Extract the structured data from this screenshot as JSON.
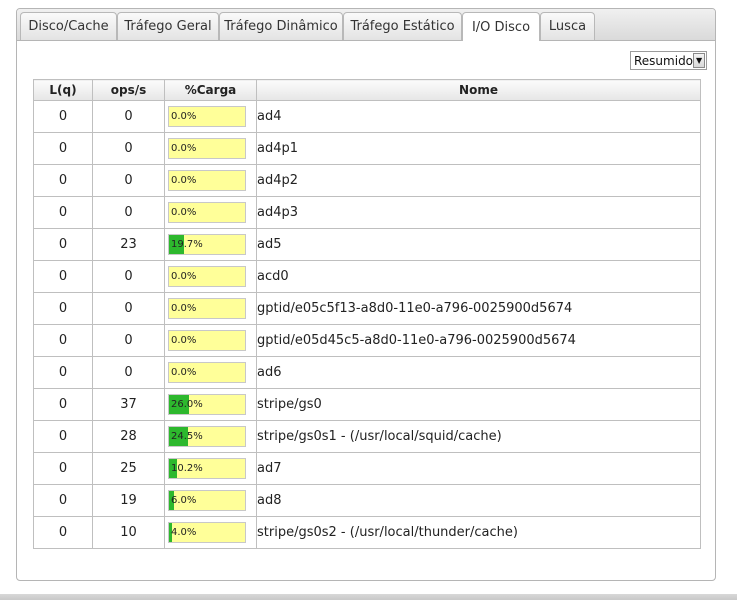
{
  "tabs": [
    {
      "label": "Disco/Cache",
      "active": false
    },
    {
      "label": "Tráfego Geral",
      "active": false
    },
    {
      "label": "Tráfego Dinâmico",
      "active": false
    },
    {
      "label": "Tráfego Estático",
      "active": false
    },
    {
      "label": "I/O Disco",
      "active": true
    },
    {
      "label": "Lusca",
      "active": false
    }
  ],
  "view_select": {
    "value": "Resumido",
    "arrow_icon": "chevron-down-icon"
  },
  "table": {
    "headers": [
      "L(q)",
      "ops/s",
      "%Carga",
      "Nome"
    ],
    "rows": [
      {
        "lq": "0",
        "ops": "0",
        "load_label": "0.0%",
        "load": 0.0,
        "name": "ad4"
      },
      {
        "lq": "0",
        "ops": "0",
        "load_label": "0.0%",
        "load": 0.0,
        "name": "ad4p1"
      },
      {
        "lq": "0",
        "ops": "0",
        "load_label": "0.0%",
        "load": 0.0,
        "name": "ad4p2"
      },
      {
        "lq": "0",
        "ops": "0",
        "load_label": "0.0%",
        "load": 0.0,
        "name": "ad4p3"
      },
      {
        "lq": "0",
        "ops": "23",
        "load_label": "19.7%",
        "load": 19.7,
        "name": "ad5"
      },
      {
        "lq": "0",
        "ops": "0",
        "load_label": "0.0%",
        "load": 0.0,
        "name": "acd0"
      },
      {
        "lq": "0",
        "ops": "0",
        "load_label": "0.0%",
        "load": 0.0,
        "name": "gptid/e05c5f13-a8d0-11e0-a796-0025900d5674"
      },
      {
        "lq": "0",
        "ops": "0",
        "load_label": "0.0%",
        "load": 0.0,
        "name": "gptid/e05d45c5-a8d0-11e0-a796-0025900d5674"
      },
      {
        "lq": "0",
        "ops": "0",
        "load_label": "0.0%",
        "load": 0.0,
        "name": "ad6"
      },
      {
        "lq": "0",
        "ops": "37",
        "load_label": "26.0%",
        "load": 26.0,
        "name": "stripe/gs0"
      },
      {
        "lq": "0",
        "ops": "28",
        "load_label": "24.5%",
        "load": 24.5,
        "name": "stripe/gs0s1 - (/usr/local/squid/cache)"
      },
      {
        "lq": "0",
        "ops": "25",
        "load_label": "10.2%",
        "load": 10.2,
        "name": "ad7"
      },
      {
        "lq": "0",
        "ops": "19",
        "load_label": "6.0%",
        "load": 6.0,
        "name": "ad8"
      },
      {
        "lq": "0",
        "ops": "10",
        "load_label": "4.0%",
        "load": 4.0,
        "name": "stripe/gs0s2 - (/usr/local/thunder/cache)"
      }
    ]
  },
  "colors": {
    "bar_background": "#ffff99",
    "bar_fill": "#2db82d"
  }
}
